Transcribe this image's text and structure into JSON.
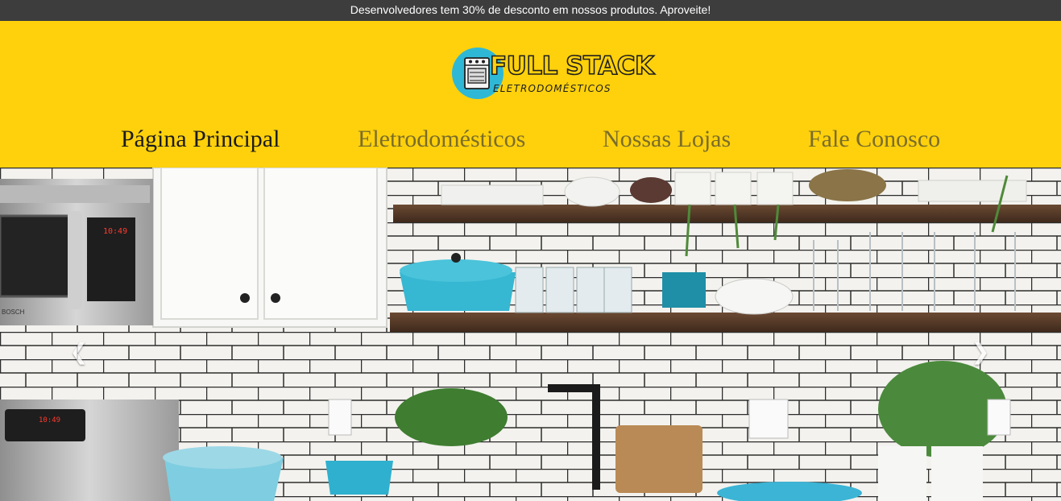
{
  "promo": {
    "text": "Desenvolvedores tem 30% de desconto em nossos produtos. Aproveite!"
  },
  "logo": {
    "title": "FULL STACK",
    "subtitle": "ELETRODOMÉSTICOS"
  },
  "nav": {
    "items": [
      {
        "label": "Página Principal",
        "active": true
      },
      {
        "label": "Eletrodomésticos",
        "active": false
      },
      {
        "label": "Nossas Lojas",
        "active": false
      },
      {
        "label": "Fale Conosco",
        "active": false
      }
    ]
  },
  "carousel": {
    "prev_icon": "chevron-left-icon",
    "next_icon": "chevron-right-icon",
    "prev_glyph": "❮",
    "next_glyph": "❯",
    "microwave_display": "10:49",
    "oven_display": "10:49"
  },
  "colors": {
    "promo_bg": "#3d3d3d",
    "header_bg": "#ffd10c",
    "logo_circle": "#2fb8d6",
    "nav_active": "#1b1b1b",
    "nav_inactive": "#7a6d2a"
  }
}
